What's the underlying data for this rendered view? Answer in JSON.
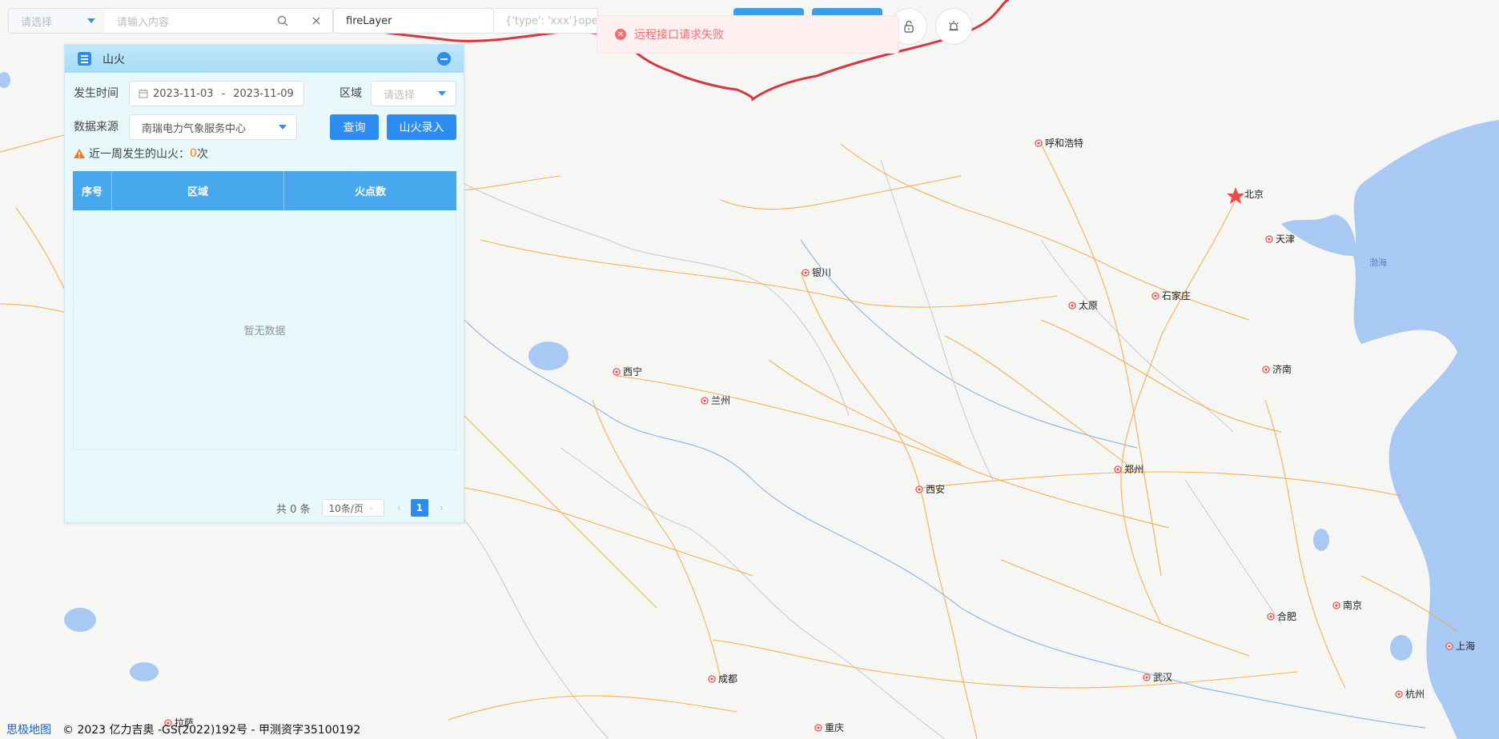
{
  "toolbar": {
    "select_placeholder": "请选择",
    "search_placeholder": "请输入内容",
    "layer_value": "fireLayer",
    "json_placeholder": "{'type': 'xxx'}open l"
  },
  "toast": {
    "message": "远程接口请求失败"
  },
  "panel": {
    "title": "山火",
    "time_label": "发生时间",
    "date_start": "2023-11-03",
    "date_sep": "-",
    "date_end": "2023-11-09",
    "region_label": "区域",
    "region_placeholder": "请选择",
    "source_label": "数据来源",
    "source_value": "南瑞电力气象服务中心",
    "query_button": "查询",
    "entry_button": "山火录入",
    "summary_prefix": "近一周发生的山火：",
    "summary_count": "0",
    "summary_suffix": " 次",
    "columns": [
      "序号",
      "区域",
      "火点数"
    ],
    "empty_text": "暂无数据",
    "pager": {
      "total": "共 0 条",
      "page_size": "10条/页",
      "current_page": "1"
    }
  },
  "map": {
    "cities": [
      "呼和浩特",
      "北京",
      "天津",
      "银川",
      "太原",
      "石家庄",
      "西宁",
      "兰州",
      "济南",
      "郑州",
      "西安",
      "合肥",
      "南京",
      "上海",
      "成都",
      "武汉",
      "杭州",
      "重庆",
      "拉萨"
    ],
    "sea_label": "渤海",
    "credit_brand": "思极地图",
    "credit_text": "© 2023 亿力吉奥 -GS(2022)192号 - 甲测资字35100192"
  },
  "colors": {
    "accent": "#2d8cf0",
    "error": "#f56c6c",
    "border_red": "#d9363e",
    "road": "#f5a43a",
    "water": "#a9c9f5"
  }
}
